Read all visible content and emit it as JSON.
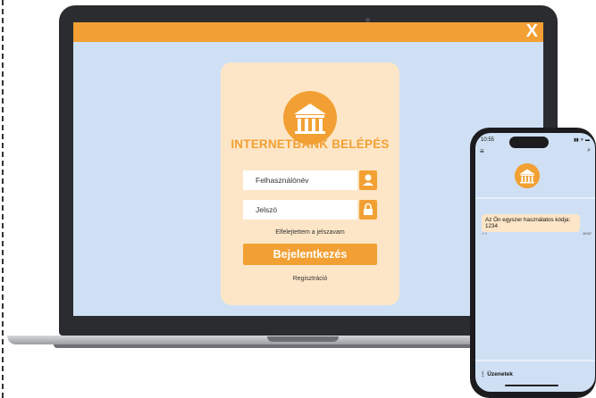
{
  "window": {
    "close_label": "X"
  },
  "login": {
    "title": "INTERNETBANK BELÉPÉS",
    "username_placeholder": "Felhasználónév",
    "password_placeholder": "Jelszó",
    "forgot_password": "Elfelejtettem a jelszavam",
    "login_button": "Bejelentkezés",
    "register": "Regisztráció"
  },
  "phone": {
    "status_time": "10:55",
    "status_icons": "▮▮ ᯤ ▬",
    "menu_icon": "≡",
    "search_icon": "⌕",
    "message": "Az Ön egyszer használatos kódja: 1234",
    "message_ticks": "✓✓",
    "message_time": "10:57",
    "footer": "⋮ Üzenetek"
  },
  "colors": {
    "accent": "#f2a033",
    "screen_bg": "#cfe0f4",
    "card_bg": "#fde6c7"
  },
  "icons": [
    "bank-icon",
    "user-icon",
    "lock-icon",
    "menu-icon",
    "search-icon",
    "close-icon"
  ]
}
